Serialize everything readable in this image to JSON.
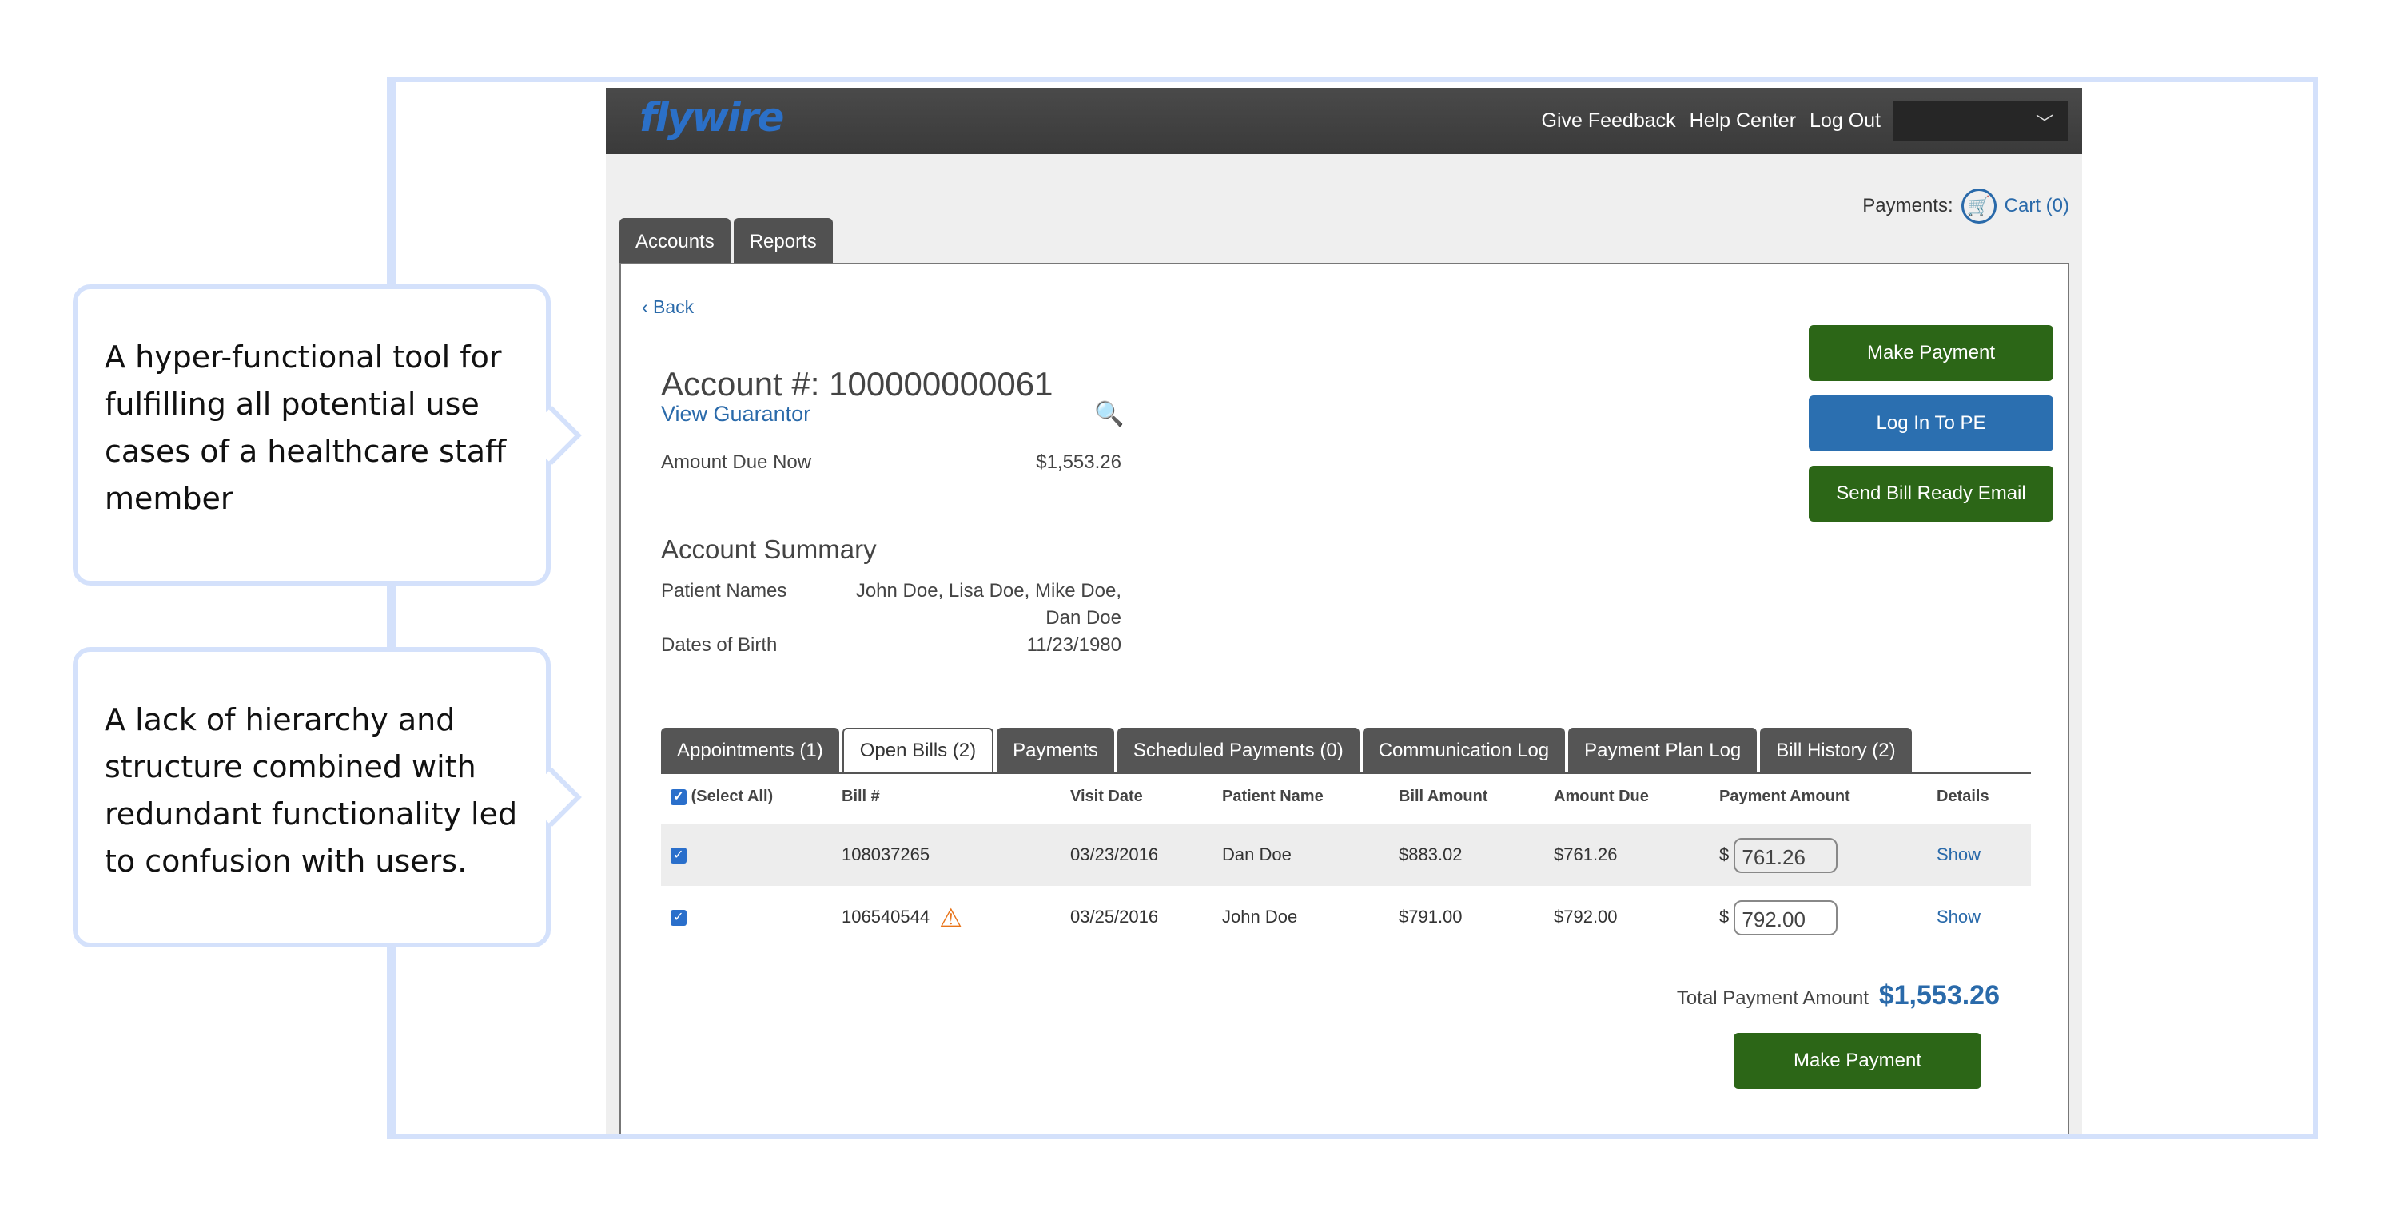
{
  "callouts": [
    "A hyper-functional tool for fulfilling all potential use cases of a healthcare staff member",
    "A lack of hierarchy and structure combined with redundant functionality led to confusion with users."
  ],
  "header": {
    "logo": "flywire",
    "links": [
      "Give Feedback",
      "Help Center",
      "Log Out"
    ]
  },
  "cart": {
    "label": "Payments:",
    "link": "Cart (0)"
  },
  "main_tabs": [
    "Accounts",
    "Reports"
  ],
  "account": {
    "back": "‹ Back",
    "title": "Account #: 100000000061",
    "view_guarantor": "View Guarantor",
    "amount_due_label": "Amount Due Now",
    "amount_due_value": "$1,553.26"
  },
  "summary": {
    "title": "Account Summary",
    "patient_names_label": "Patient Names",
    "patient_names_line1": "John Doe, Lisa Doe, Mike Doe,",
    "patient_names_line2": "Dan Doe",
    "dob_label": "Dates of Birth",
    "dob_value": "11/23/1980"
  },
  "actions": {
    "make_payment": "Make Payment",
    "log_in_pe": "Log In To PE",
    "send_bill": "Send Bill Ready Email"
  },
  "sub_tabs": [
    "Appointments (1)",
    "Open Bills (2)",
    "Payments",
    "Scheduled Payments (0)",
    "Communication Log",
    "Payment Plan Log",
    "Bill History (2)"
  ],
  "sub_tab_active": "Open Bills (2)",
  "table": {
    "headers": [
      "(Select All)",
      "Bill #",
      "Visit Date",
      "Patient Name",
      "Bill Amount",
      "Amount Due",
      "Payment Amount",
      "Details"
    ],
    "currency_prefix": "$",
    "rows": [
      {
        "bill": "108037265",
        "visit_date": "03/23/2016",
        "patient": "Dan Doe",
        "bill_amount": "$883.02",
        "amount_due": "$761.26",
        "payment": "761.26",
        "details": "Show",
        "warning": false
      },
      {
        "bill": "106540544",
        "visit_date": "03/25/2016",
        "patient": "John Doe",
        "bill_amount": "$791.00",
        "amount_due": "$792.00",
        "payment": "792.00",
        "details": "Show",
        "warning": true
      }
    ]
  },
  "total": {
    "label": "Total Payment Amount",
    "value": "$1,553.26"
  },
  "bottom_button": "Make Payment"
}
